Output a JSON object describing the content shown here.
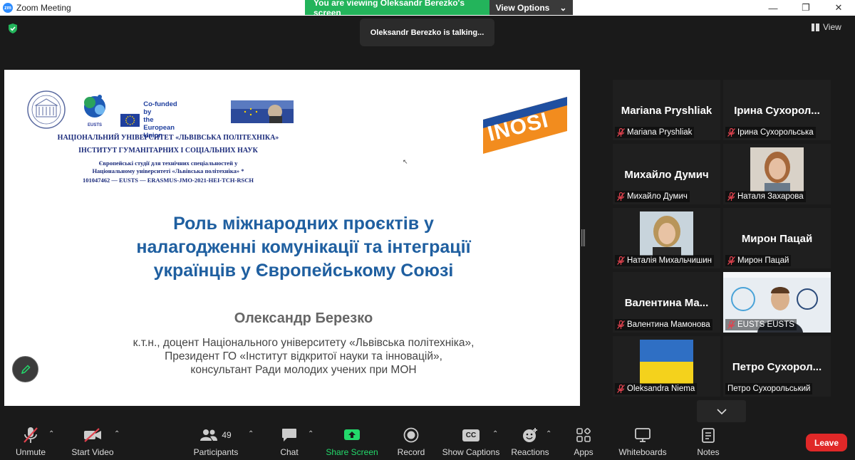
{
  "window": {
    "app_logo": "zm",
    "title": "Zoom Meeting"
  },
  "share_banner": {
    "text": "You are viewing Oleksandr Berezko's screen",
    "options_label": "View Options"
  },
  "talking_notice": "Oleksandr Berezko is talking...",
  "view_label": "View",
  "slide": {
    "eu_text_line1": "Co-funded by",
    "eu_text_line2": "the European Union",
    "logo_inosi": "INOSI",
    "eusts_label": "EUSTS",
    "header_line1": "НАЦІОНАЛЬНИЙ УНІВЕРСИТЕТ «ЛЬВІВСЬКА ПОЛІТЕХНІКА»",
    "header_line2": "ІНСТИТУТ ГУМАНІТАРНИХ І СОЦІАЛЬНИХ НАУК",
    "header_line3a": "Європейські студії для технічних спеціальностей у",
    "header_line3b": "Національному університеті «Львівська політехніка» *",
    "header_line4": "101047462 — EUSTS — ERASMUS-JMO-2021-HEI-TCH-RSCH",
    "title_line1": "Роль міжнародних проєктів у",
    "title_line2": "налагодженні комунікації та інтеграції",
    "title_line3": "українців у Європейському Союзі",
    "author": "Олександр Березко",
    "desc_line1": "к.т.н., доцент Національного університету «Львівська політехніка»,",
    "desc_line2": "Президент ГО «Інститут відкритої науки та інновацій»,",
    "desc_line3": "консультант Ради молодих учених при МОН"
  },
  "participants_tiles": [
    {
      "display": "Mariana Pryshliak",
      "label": "Mariana Pryshliak",
      "muted": true,
      "video": "none"
    },
    {
      "display": "Ірина  Сухорол...",
      "label": "Ірина Сухорольська",
      "muted": true,
      "video": "none"
    },
    {
      "display": "Михайло Думич",
      "label": "Михайло Думич",
      "muted": true,
      "video": "none"
    },
    {
      "display": "",
      "label": "Наталя Захарова",
      "muted": true,
      "video": "photo"
    },
    {
      "display": "",
      "label": "Наталія Михальчишин",
      "muted": true,
      "video": "photo"
    },
    {
      "display": "Мирон Пацай",
      "label": "Мирон Пацай",
      "muted": true,
      "video": "none"
    },
    {
      "display": "Валентина  Ма...",
      "label": "Валентина Мамонова",
      "muted": true,
      "video": "none"
    },
    {
      "display": "",
      "label": "EUSTS EUSTS",
      "muted": true,
      "video": "camera"
    },
    {
      "display": "",
      "label": "Oleksandra Niema",
      "muted": true,
      "video": "flag"
    },
    {
      "display": "Петро  Сухорол...",
      "label": "Петро Сухорольський",
      "muted": false,
      "video": "none"
    }
  ],
  "toolbar": {
    "unmute": "Unmute",
    "start_video": "Start Video",
    "participants": "Participants",
    "participants_count": "49",
    "chat": "Chat",
    "share_screen": "Share Screen",
    "record": "Record",
    "show_captions": "Show Captions",
    "cc_badge": "CC",
    "reactions": "Reactions",
    "apps": "Apps",
    "whiteboards": "Whiteboards",
    "notes": "Notes",
    "leave": "Leave"
  },
  "colors": {
    "share_green": "#23b45b",
    "leave_red": "#e02828",
    "slide_title_blue": "#1f5fa0",
    "mute_red": "#e0424e"
  }
}
